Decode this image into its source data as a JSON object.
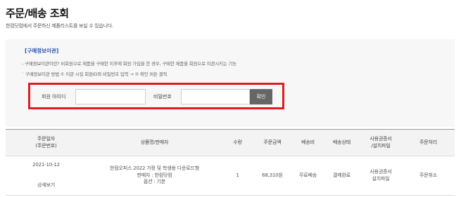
{
  "page": {
    "title": "주문/배송 조회",
    "subtitle": "한컴닷컴에서 주문하신 제품리스트를 보실 수 있습니다."
  },
  "info": {
    "heading": "[구매정보이관]",
    "line1": "- 구매정보이관이란?    비회원으로 제품을 구매한 이후에 회원 가입을 한 경우, 구매한 제품을 회원으로 이관시키는 기능",
    "line2": "˙ 구매정보이관 방법    ① 이관 시킬 회원ID와 비밀번호 입력   →   ② 확인 버튼 클릭"
  },
  "auth": {
    "id_label": "회원 아이디",
    "id_value": "",
    "pw_label": "비밀번호",
    "pw_value": "",
    "confirm_label": "확인"
  },
  "table": {
    "headers": {
      "date_line1": "주문일자",
      "date_line2": "(주문번호)",
      "product": "상품명/판매자",
      "qty": "수량",
      "amount": "주문금액",
      "shipping_fee": "배송비",
      "shipping_status": "배송상태",
      "license_line1": "사용권증서",
      "license_line2": "/설치파일",
      "process": "주문처리"
    },
    "rows": [
      {
        "date": "2021-10-12",
        "detail": "상세보기",
        "product_name": "한컴오피스 2022 가정 및 학생용 다운로드형",
        "seller": "판매자 : 한컴닷컴",
        "option": "옵션 : 기본",
        "qty": "1",
        "amount": "68,310원",
        "shipping_fee": "무료배송",
        "shipping_status": "결제완료",
        "license_line1": "사용권증서",
        "license_line2": "설치파일",
        "process": "주문취소"
      }
    ]
  }
}
